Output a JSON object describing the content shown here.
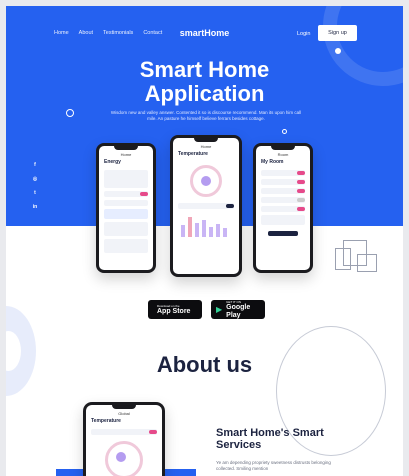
{
  "nav": {
    "items": [
      "Home",
      "About",
      "Testimonials",
      "Contact"
    ],
    "brand": "smartHome",
    "login": "Login",
    "signup": "Sign up"
  },
  "hero": {
    "title_line1": "Smart Home",
    "title_line2": "Application",
    "subtitle": "Wisdom new and valley answer. Contented it so is discourse recommend. Man its upon him call mile. An pasture he himself believe ferrars besides cottage."
  },
  "social": [
    "f",
    "◎",
    "t",
    "in"
  ],
  "phones": {
    "energy": {
      "header": "Home",
      "title": "Energy"
    },
    "temperature": {
      "header": "Home",
      "title": "Temperature"
    },
    "room": {
      "header": "Room",
      "title": "My Room"
    }
  },
  "stores": {
    "apple": {
      "small": "Download on the",
      "big": "App Store",
      "icon": "apple-icon"
    },
    "google": {
      "small": "GET IT ON",
      "big": "Google Play",
      "icon": "play-icon"
    }
  },
  "about": {
    "heading": "About us",
    "phone_header": "Global",
    "phone_title": "Temperature",
    "subheading_line1": "Smart Home's  Smart",
    "subheading_line2": "Services",
    "paragraph": "Ye am depending propriety sweetness distrusts belonging collected. Smiling mention"
  }
}
